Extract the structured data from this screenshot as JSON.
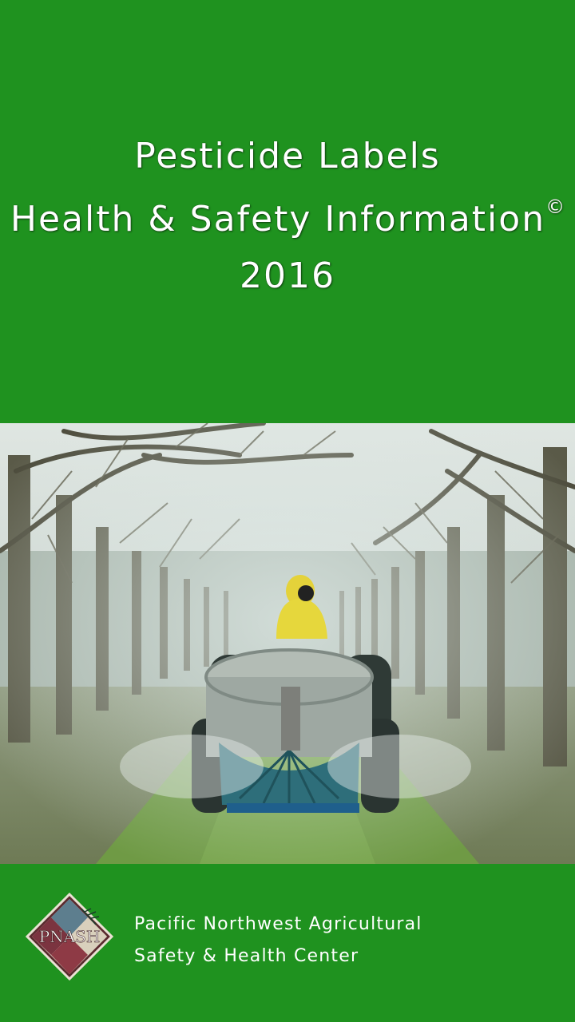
{
  "header": {
    "title_line1": "Pesticide Labels",
    "title_line2": "Health & Safety Information",
    "title_symbol": "©",
    "title_line3": "2016"
  },
  "cover_image": {
    "subject": "orchard-sprayer-photo"
  },
  "footer": {
    "logo_text": "PNASH",
    "org_line1": "Pacific Northwest Agricultural",
    "org_line2": "Safety & Health Center"
  },
  "colors": {
    "background_green": "#1f921f",
    "title_text": "#ffffff"
  }
}
